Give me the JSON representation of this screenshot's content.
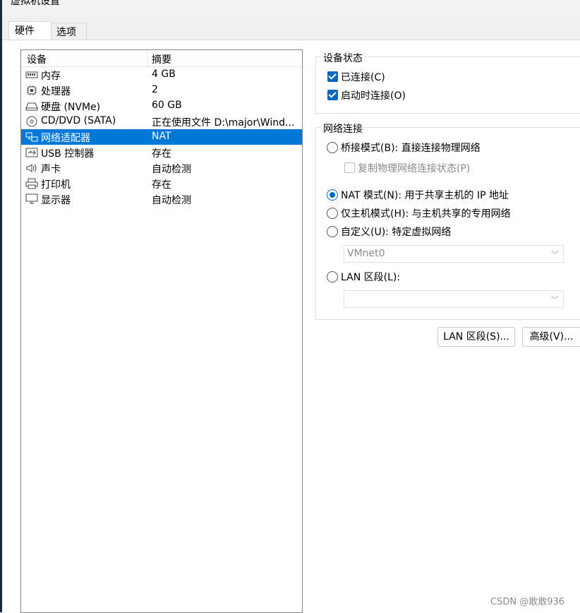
{
  "window": {
    "title": "虚拟机设置"
  },
  "tabs": [
    {
      "label": "硬件",
      "active": true
    },
    {
      "label": "选项",
      "active": false
    }
  ],
  "device_list": {
    "columns": [
      "设备",
      "摘要"
    ],
    "rows": [
      {
        "icon": "memory-icon",
        "name": "内存",
        "summary": "4 GB",
        "selected": false
      },
      {
        "icon": "processor-icon",
        "name": "处理器",
        "summary": "2",
        "selected": false
      },
      {
        "icon": "hard-disk-icon",
        "name": "硬盘 (NVMe)",
        "summary": "60 GB",
        "selected": false
      },
      {
        "icon": "cd-dvd-icon",
        "name": "CD/DVD (SATA)",
        "summary": "正在使用文件 D:\\major\\Wind...",
        "selected": false
      },
      {
        "icon": "network-adapter-icon",
        "name": "网络适配器",
        "summary": "NAT",
        "selected": true
      },
      {
        "icon": "usb-icon",
        "name": "USB 控制器",
        "summary": "存在",
        "selected": false
      },
      {
        "icon": "sound-icon",
        "name": "声卡",
        "summary": "自动检测",
        "selected": false
      },
      {
        "icon": "printer-icon",
        "name": "打印机",
        "summary": "存在",
        "selected": false
      },
      {
        "icon": "display-icon",
        "name": "显示器",
        "summary": "自动检测",
        "selected": false
      }
    ]
  },
  "device_status": {
    "title": "设备状态",
    "connected": {
      "label": "已连接(C)",
      "checked": true
    },
    "connect_at_power_on": {
      "label": "启动时连接(O)",
      "checked": true
    }
  },
  "network_connection": {
    "title": "网络连接",
    "bridged": {
      "label": "桥接模式(B): 直接连接物理网络",
      "selected": false
    },
    "replicate": {
      "label": "复制物理网络连接状态(P)",
      "checked": false,
      "enabled": false
    },
    "nat": {
      "label": "NAT 模式(N): 用于共享主机的 IP 地址",
      "selected": true
    },
    "host_only": {
      "label": "仅主机模式(H): 与主机共享的专用网络",
      "selected": false
    },
    "custom": {
      "label": "自定义(U): 特定虚拟网络",
      "selected": false
    },
    "custom_network": {
      "value": "VMnet0",
      "enabled": false
    },
    "lan_segment": {
      "label": "LAN 区段(L):",
      "selected": false
    },
    "lan_segment_select": {
      "value": "",
      "enabled": false
    }
  },
  "buttons": {
    "lan_segments": "LAN 区段(S)...",
    "advanced": "高级(V)..."
  },
  "watermark": "CSDN @敢敢936",
  "colors": {
    "selection": "#0078d7",
    "accent": "#0067c0"
  }
}
